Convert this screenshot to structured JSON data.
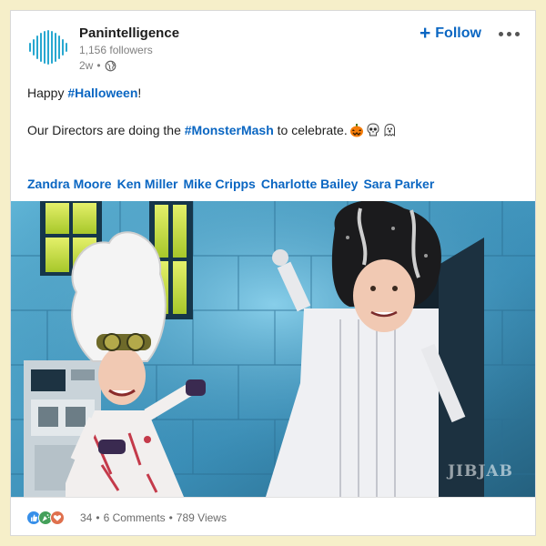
{
  "post": {
    "company_name": "Panintelligence",
    "followers": "1,156 followers",
    "age": "2w",
    "follow_label": "Follow",
    "follow_plus": "+",
    "text": {
      "greeting_prefix": "Happy ",
      "greeting_hashtag": "#Halloween",
      "greeting_suffix": "!",
      "line2_prefix": "Our Directors are doing the ",
      "line2_hashtag": "#MonsterMash",
      "line2_suffix": " to celebrate."
    },
    "emojis": [
      "jack-o-lantern-icon",
      "skull-icon",
      "ghost-icon"
    ],
    "tagged_people": [
      "Zandra Moore",
      "Ken Miller",
      "Mike Cripps",
      "Charlotte Bailey",
      "Sara Parker"
    ],
    "media": {
      "watermark": "JIBJAB"
    }
  },
  "footer": {
    "reaction_icons": [
      "like-icon",
      "celebrate-icon",
      "love-icon"
    ],
    "reaction_count": "34",
    "separator": "•",
    "comments": "6 Comments",
    "views": "789 Views"
  },
  "colors": {
    "link_blue": "#0a66c2",
    "logo_blue": "#28a8d0",
    "page_bg": "#f6efc9",
    "muted_text": "#808080"
  }
}
